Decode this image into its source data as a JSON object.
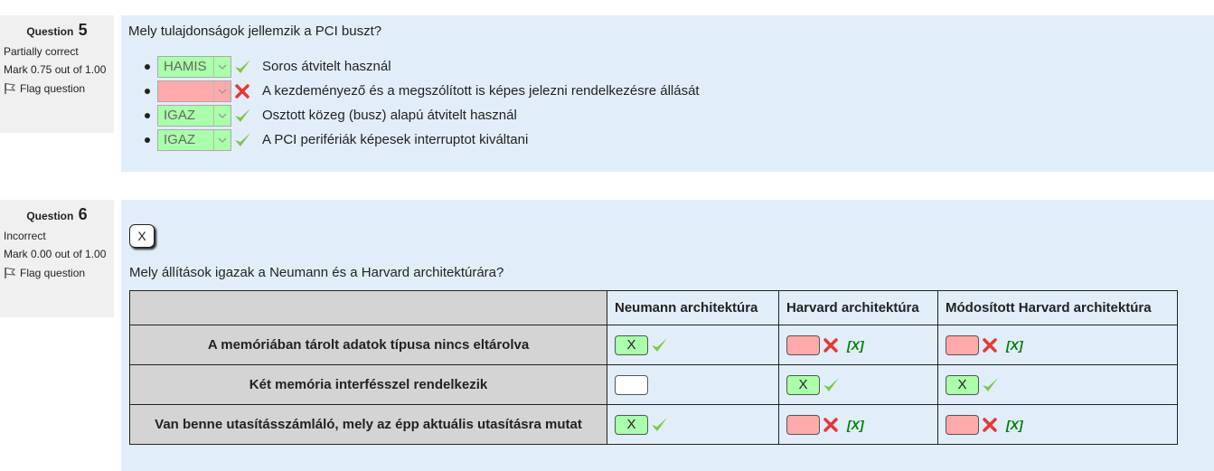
{
  "q5": {
    "label": "Question",
    "number": "5",
    "state": "Partially correct",
    "grade": "Mark 0.75 out of 1.00",
    "flag": "Flag question",
    "question_text": "Mely tulajdonságok jellemzik a PCI buszt?",
    "answers": [
      {
        "value": "HAMIS",
        "status": "correct",
        "text": "Soros átvitelt használ"
      },
      {
        "value": "",
        "status": "incorrect",
        "text": "A kezdeményező és a megszólított is képes jelezni rendelkezésre állását"
      },
      {
        "value": "IGAZ",
        "status": "correct",
        "text": "Osztott közeg (busz) alapú átvitelt használ"
      },
      {
        "value": "IGAZ",
        "status": "correct",
        "text": "A PCI perifériák képesek interruptot kiváltani"
      }
    ]
  },
  "q6": {
    "label": "Question",
    "number": "6",
    "state": "Incorrect",
    "grade": "Mark 0.00 out of 1.00",
    "flag": "Flag question",
    "button_label": "X",
    "question_text": "Mely állítások igazak a Neumann és a Harvard architektúrára?",
    "columns": [
      "Neumann architektúra",
      "Harvard architektúra",
      "Módosított Harvard architektúra"
    ],
    "rows": [
      {
        "label": "A memóriában tárolt adatok típusa nincs eltárolva",
        "cells": [
          {
            "mark": "X",
            "status": "correct",
            "correction": ""
          },
          {
            "mark": "",
            "status": "incorrect",
            "correction": "[X]"
          },
          {
            "mark": "",
            "status": "incorrect",
            "correction": "[X]"
          }
        ]
      },
      {
        "label": "Két memória interfésszel rendelkezik",
        "cells": [
          {
            "mark": "",
            "status": "empty",
            "correction": ""
          },
          {
            "mark": "X",
            "status": "correct",
            "correction": ""
          },
          {
            "mark": "X",
            "status": "correct",
            "correction": ""
          }
        ]
      },
      {
        "label": "Van benne utasításszámláló, mely az épp aktuális utasításra mutat",
        "cells": [
          {
            "mark": "X",
            "status": "correct",
            "correction": ""
          },
          {
            "mark": "",
            "status": "incorrect",
            "correction": "[X]"
          },
          {
            "mark": "",
            "status": "incorrect",
            "correction": "[X]"
          }
        ]
      }
    ]
  },
  "colors": {
    "correct_bg": "#aaffaa",
    "incorrect_bg": "#ffaaaa",
    "content_bg": "#e1eefa",
    "info_bg": "#f0f0f0",
    "check": "#7ac943",
    "cross": "#e53935",
    "correction": "#008000"
  }
}
